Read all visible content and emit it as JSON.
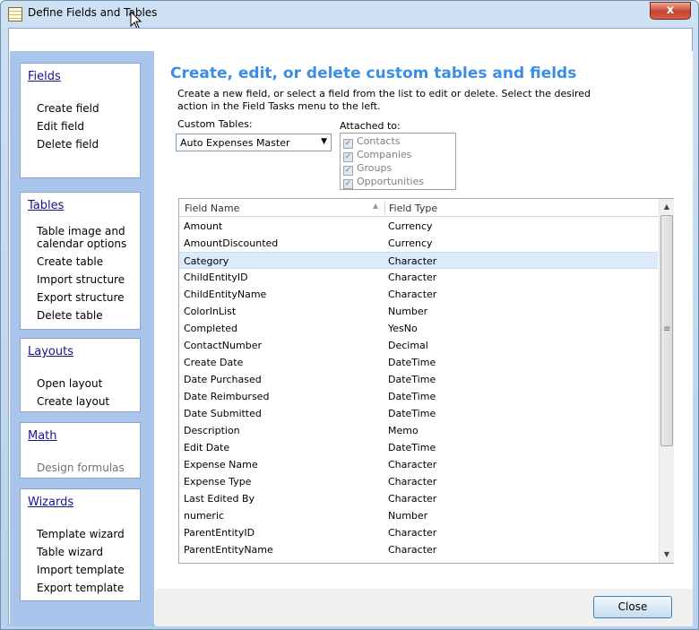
{
  "window": {
    "title": "Define Fields and Tables",
    "close_glyph": "x"
  },
  "sidebar": {
    "fields": {
      "header": "Fields",
      "items": [
        "Create field",
        "Edit field",
        "Delete field"
      ]
    },
    "tables": {
      "header": "Tables",
      "items": [
        "Table image and calendar options",
        "Create table",
        "Import structure",
        "Export structure",
        "Delete table"
      ]
    },
    "layouts": {
      "header": "Layouts",
      "items": [
        "Open layout",
        "Create layout"
      ]
    },
    "math": {
      "header": "Math",
      "items": [
        "Design formulas"
      ]
    },
    "wizards": {
      "header": "Wizards",
      "items": [
        "Template wizard",
        "Table wizard",
        "Import template",
        "Export template"
      ]
    }
  },
  "main": {
    "heading": "Create, edit, or delete custom tables and fields",
    "description": "Create a new field, or select a field from the list to edit or delete. Select the desired action in the Field Tasks menu to the left.",
    "custom_tables_label": "Custom Tables:",
    "custom_tables_value": "Auto Expenses Master",
    "attached_to_label": "Attached to:",
    "attached_to": [
      "Contacts",
      "Companies",
      "Groups",
      "Opportunities"
    ],
    "grid": {
      "columns": [
        "Field Name",
        "Field Type"
      ],
      "selected_row": "Category",
      "rows": [
        [
          "Amount",
          "Currency"
        ],
        [
          "AmountDiscounted",
          "Currency"
        ],
        [
          "Category",
          "Character"
        ],
        [
          "ChildEntityID",
          "Character"
        ],
        [
          "ChildEntityName",
          "Character"
        ],
        [
          "ColorInList",
          "Number"
        ],
        [
          "Completed",
          "YesNo"
        ],
        [
          "ContactNumber",
          "Decimal"
        ],
        [
          "Create Date",
          "DateTime"
        ],
        [
          "Date Purchased",
          "DateTime"
        ],
        [
          "Date Reimbursed",
          "DateTime"
        ],
        [
          "Date Submitted",
          "DateTime"
        ],
        [
          "Description",
          "Memo"
        ],
        [
          "Edit Date",
          "DateTime"
        ],
        [
          "Expense Name",
          "Character"
        ],
        [
          "Expense Type",
          "Character"
        ],
        [
          "Last Edited By",
          "Character"
        ],
        [
          "numeric",
          "Number"
        ],
        [
          "ParentEntityID",
          "Character"
        ],
        [
          "ParentEntityName",
          "Character"
        ]
      ]
    }
  },
  "footer": {
    "close_label": "Close"
  },
  "colors": {
    "heading": "#3a8ee6",
    "sidebar_bg": "#a9c5ec",
    "link": "#14168c",
    "selected_row": "#dcebfc"
  }
}
